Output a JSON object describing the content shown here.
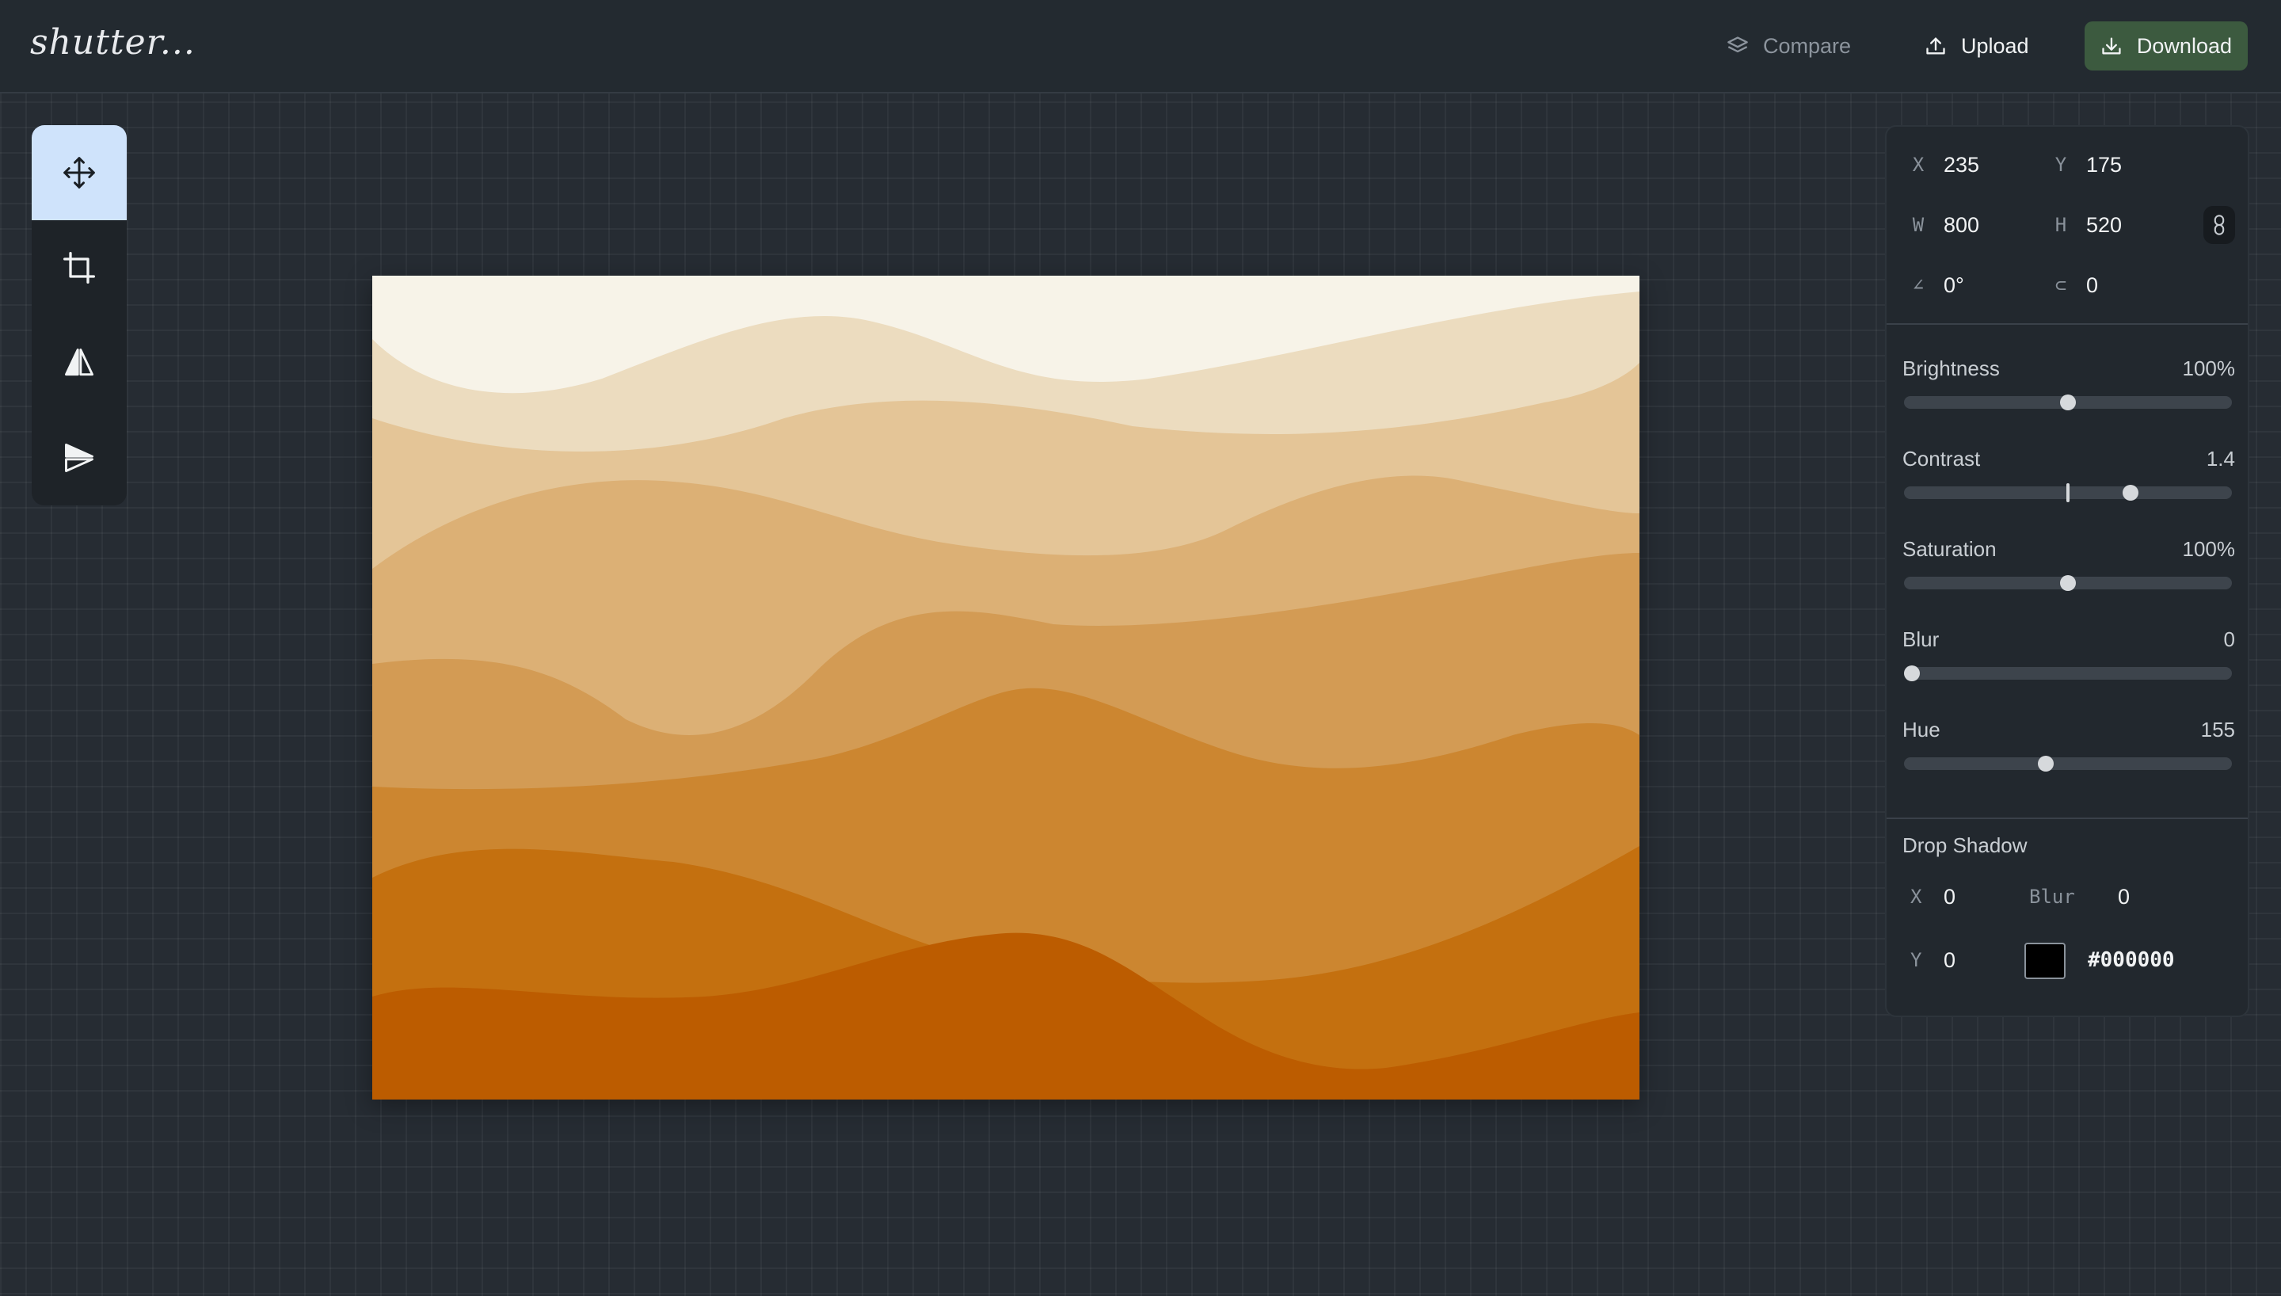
{
  "app": {
    "logo": "shutter..."
  },
  "topbar": {
    "compare_label": "Compare",
    "upload_label": "Upload",
    "download_label": "Download",
    "download_color": "#3c5a3f"
  },
  "tools": [
    {
      "name": "move",
      "icon": "move-icon",
      "active": true
    },
    {
      "name": "crop",
      "icon": "crop-icon",
      "active": false
    },
    {
      "name": "flip-horizontal",
      "icon": "flip-horizontal-icon",
      "active": false
    },
    {
      "name": "flip-vertical",
      "icon": "flip-vertical-icon",
      "active": false
    }
  ],
  "transform": {
    "x": {
      "key": "X",
      "value": "235"
    },
    "y": {
      "key": "Y",
      "value": "175"
    },
    "w": {
      "key": "W",
      "value": "800"
    },
    "h": {
      "key": "H",
      "value": "520"
    },
    "angle": {
      "key": "∠",
      "value": "0°"
    },
    "radius": {
      "key": "⊂",
      "value": "0"
    }
  },
  "adjustments": [
    {
      "label": "Brightness",
      "value": "100%",
      "fraction": 0.5
    },
    {
      "label": "Contrast",
      "value": "1.4",
      "fraction": 0.7,
      "default_fraction": 0.5
    },
    {
      "label": "Saturation",
      "value": "100%",
      "fraction": 0.5
    },
    {
      "label": "Blur",
      "value": "0",
      "fraction": 0.0
    },
    {
      "label": "Hue",
      "value": "155",
      "fraction": 0.43
    }
  ],
  "drop_shadow": {
    "title": "Drop Shadow",
    "x_key": "X",
    "x_value": "0",
    "blur_key": "Blur",
    "blur_value": "0",
    "y_key": "Y",
    "y_value": "0",
    "color": "#000000"
  },
  "image_palette": [
    "#f7f3e8",
    "#ecdcbf",
    "#e4c597",
    "#dcb075",
    "#d39b54",
    "#cc8630",
    "#c4700f",
    "#bc5c00"
  ]
}
